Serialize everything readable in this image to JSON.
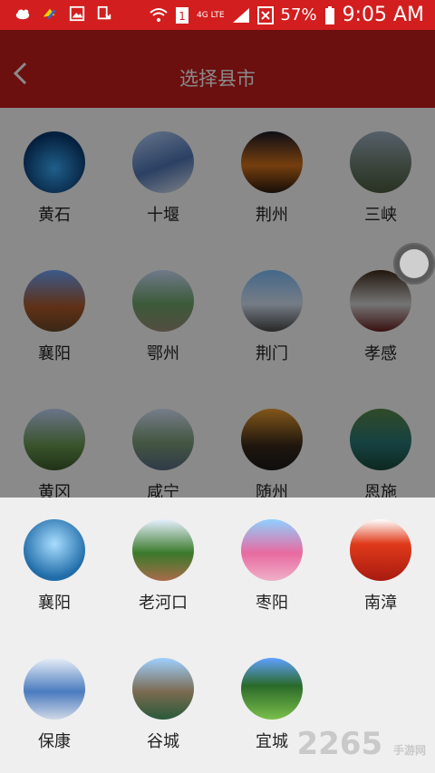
{
  "status_bar": {
    "battery": "57%",
    "time": "9:05 AM",
    "network": "4G LTE"
  },
  "header": {
    "title": "选择县市"
  },
  "cities": [
    {
      "name": "黄石"
    },
    {
      "name": "十堰"
    },
    {
      "name": "荆州"
    },
    {
      "name": "三峡"
    },
    {
      "name": "襄阳"
    },
    {
      "name": "鄂州"
    },
    {
      "name": "荆门"
    },
    {
      "name": "孝感"
    },
    {
      "name": "黄冈"
    },
    {
      "name": "咸宁"
    },
    {
      "name": "随州"
    },
    {
      "name": "恩施"
    }
  ],
  "sheet": {
    "items": [
      {
        "name": "襄阳"
      },
      {
        "name": "老河口"
      },
      {
        "name": "枣阳"
      },
      {
        "name": "南漳"
      },
      {
        "name": "保康"
      },
      {
        "name": "谷城"
      },
      {
        "name": "宜城"
      }
    ]
  },
  "watermark": {
    "text": "2265",
    "sub": "手游网"
  }
}
